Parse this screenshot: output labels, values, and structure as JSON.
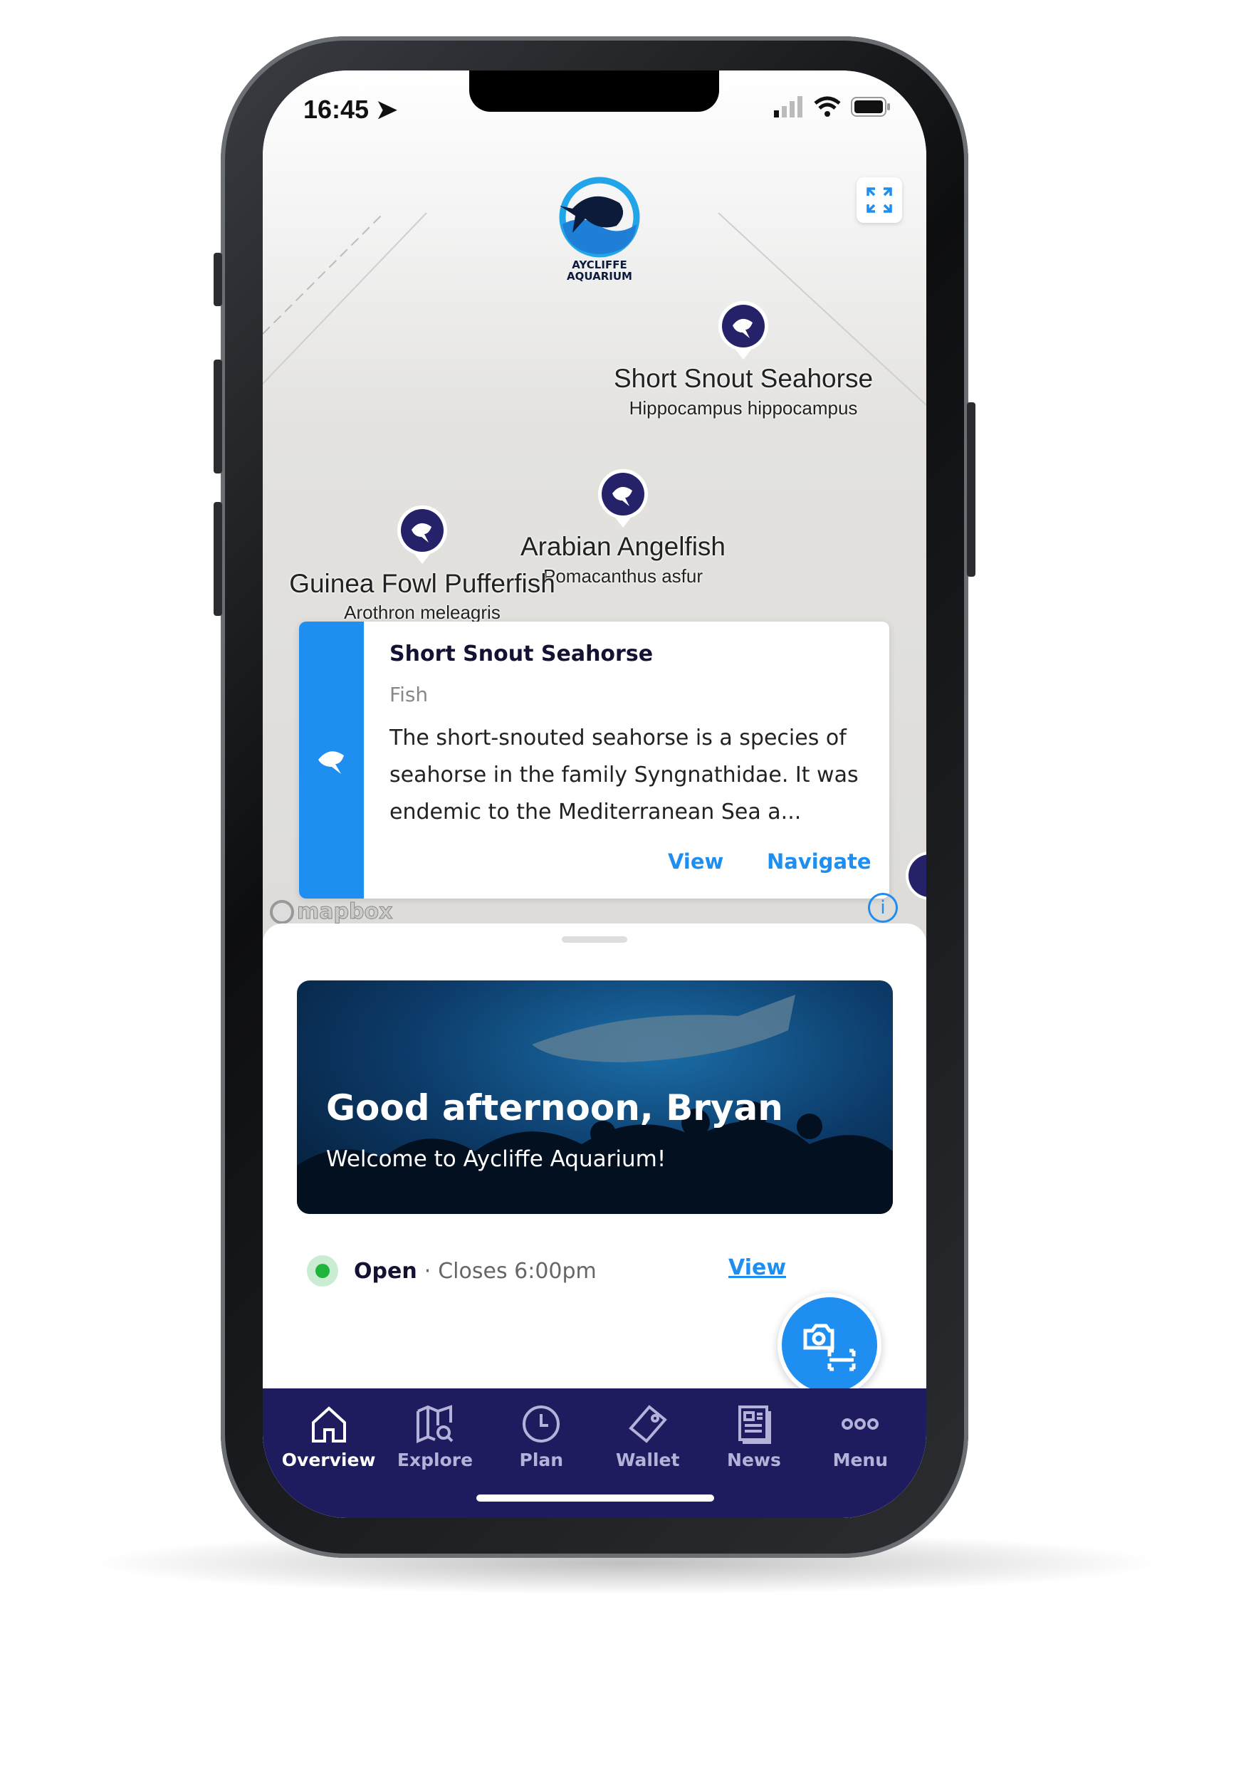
{
  "status_bar": {
    "time": "16:45"
  },
  "brand": {
    "logo_text": "AYCLIFFE AQUARIUM",
    "accent": "#1f8ef1",
    "nav_bg": "#1e1b5e"
  },
  "map": {
    "markers": [
      {
        "name": "Short Snout Seahorse",
        "scientific": "Hippocampus hippocampus",
        "icon": "fish-icon"
      },
      {
        "name": "Arabian Angelfish",
        "scientific": "Pomacanthus asfur",
        "icon": "fish-icon"
      },
      {
        "name": "Guinea Fowl Pufferfish",
        "scientific": "Arothron meleagris",
        "icon": "fish-icon"
      }
    ],
    "attribution": "mapbox",
    "info_label": "i"
  },
  "card": {
    "title": "Short Snout Seahorse",
    "category": "Fish",
    "description": "The short-snouted seahorse is a species of seahorse in the family Syngnathidae. It was endemic to the Mediterranean Sea a...",
    "view_label": "View",
    "navigate_label": "Navigate"
  },
  "hero": {
    "greeting": "Good afternoon, Bryan",
    "subtitle": "Welcome to Aycliffe Aquarium!"
  },
  "status": {
    "open": "Open",
    "separator": "·",
    "closes": "Closes 6:00pm",
    "view_label": "View",
    "status_color": "#1fb43c"
  },
  "nav": {
    "items": [
      {
        "label": "Overview",
        "icon": "home-icon",
        "active": true
      },
      {
        "label": "Explore",
        "icon": "map-search-icon"
      },
      {
        "label": "Plan",
        "icon": "clock-icon"
      },
      {
        "label": "Wallet",
        "icon": "ticket-icon"
      },
      {
        "label": "News",
        "icon": "newspaper-icon"
      },
      {
        "label": "Menu",
        "icon": "more-icon"
      }
    ]
  }
}
